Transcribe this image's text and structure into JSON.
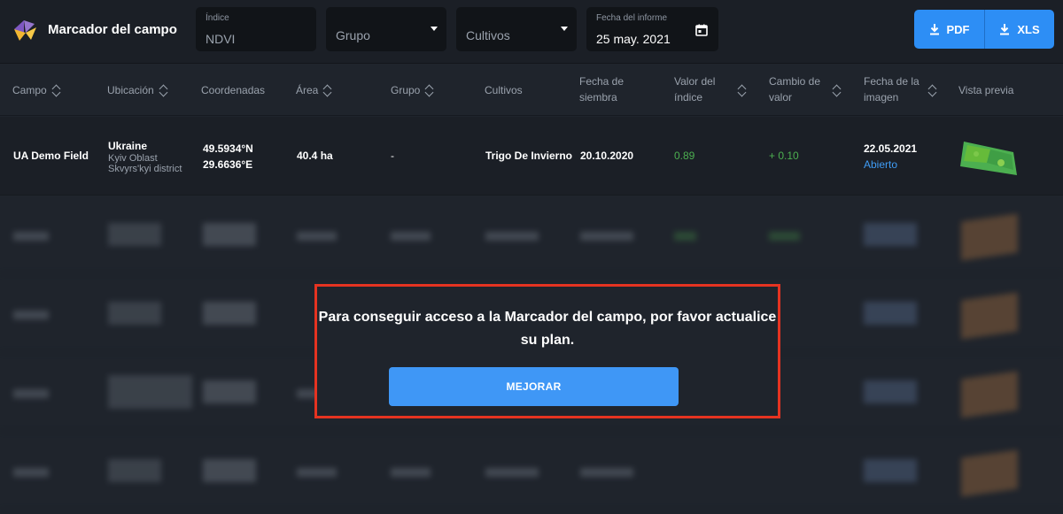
{
  "app": {
    "title": "Marcador del campo"
  },
  "filters": {
    "index": {
      "label": "Índice",
      "value": "NDVI"
    },
    "group": {
      "placeholder": "Grupo"
    },
    "crops": {
      "placeholder": "Cultivos"
    },
    "report_date": {
      "label": "Fecha del informe",
      "value": "25 may. 2021"
    }
  },
  "export": {
    "pdf_label": "PDF",
    "xls_label": "XLS"
  },
  "table": {
    "headers": {
      "field": "Campo",
      "location": "Ubicación",
      "coordinates": "Coordenadas",
      "area": "Área",
      "group": "Grupo",
      "crops": "Cultivos",
      "sowing_date_1": "Fecha de",
      "sowing_date_2": "siembra",
      "index_value_1": "Valor del",
      "index_value_2": "índice",
      "value_change_1": "Cambio de",
      "value_change_2": "valor",
      "image_date_1": "Fecha de la",
      "image_date_2": "imagen",
      "preview": "Vista previa"
    },
    "row": {
      "field": "UA Demo Field",
      "country": "Ukraine",
      "oblast": "Kyiv Oblast",
      "district": "Skvyrs'kyi district",
      "lat": "49.5934°N",
      "lon": "29.6636°E",
      "area": "40.4 ha",
      "group": "-",
      "crop": "Trigo De Invierno",
      "sowing_date": "20.10.2020",
      "index_value": "0.89",
      "value_change": "+ 0.10",
      "image_date": "22.05.2021",
      "image_link": "Abierto"
    }
  },
  "modal": {
    "message": "Para conseguir acceso a la Marcador del campo, por favor actualice su plan.",
    "button_label": "MEJORAR"
  },
  "colors": {
    "accent": "#2d8ef5",
    "highlight_border": "#e53321",
    "positive": "#4caf50"
  }
}
